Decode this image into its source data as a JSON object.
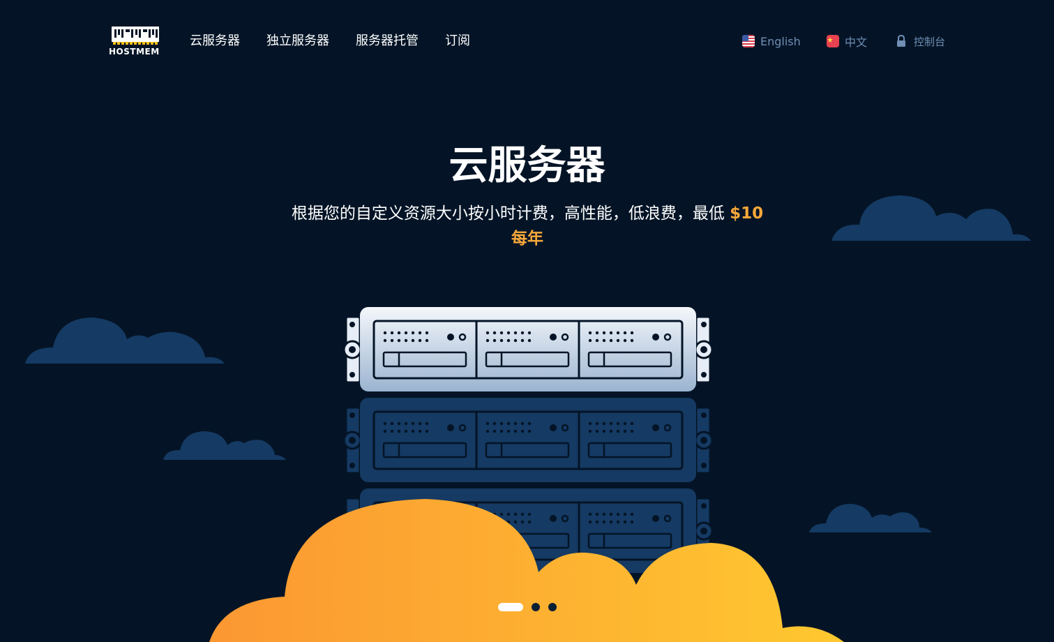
{
  "brand": {
    "name": "HOSTMEM",
    "accent": "#f9a83a",
    "background": "#041426",
    "cloud_color": "#153a63"
  },
  "nav": {
    "items": [
      {
        "label": "云服务器"
      },
      {
        "label": "独立服务器"
      },
      {
        "label": "服务器托管"
      },
      {
        "label": "订阅"
      }
    ]
  },
  "topbar": {
    "english_label": "English",
    "english_icon": "us-flag-icon",
    "chinese_label": "中文",
    "chinese_icon": "cn-flag-icon",
    "console_label": "控制台",
    "console_icon": "lock-icon"
  },
  "hero": {
    "title": "云服务器",
    "subtitle": "根据您的自定义资源大小按小时计费，高性能，低浪费，最低 ",
    "price": "$10",
    "period": "每年"
  },
  "carousel": {
    "slide_count": 3,
    "active_index": 0
  }
}
